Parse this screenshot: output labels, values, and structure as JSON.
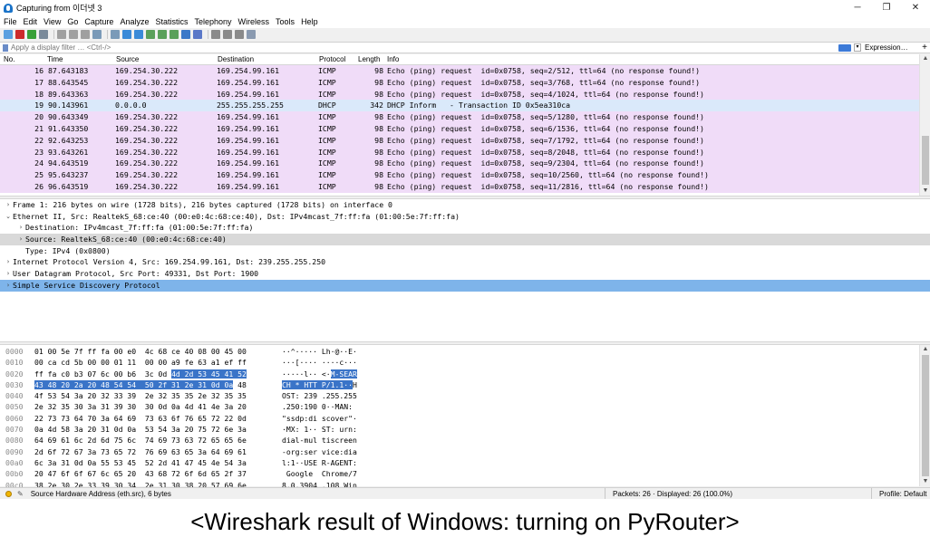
{
  "window": {
    "title": "Capturing from 이더넷 3",
    "controls": {
      "minimize": "─",
      "maximize": "❐",
      "close": "✕"
    }
  },
  "menu": [
    "File",
    "Edit",
    "View",
    "Go",
    "Capture",
    "Analyze",
    "Statistics",
    "Telephony",
    "Wireless",
    "Tools",
    "Help"
  ],
  "toolbar": {
    "icons": [
      "shark-fin-start-icon",
      "stop-capture-icon",
      "restart-capture-icon",
      "capture-options-icon",
      "open-file-icon",
      "save-file-icon",
      "close-file-icon",
      "reload-icon",
      "find-packet-icon",
      "go-back-icon",
      "go-forward-icon",
      "go-to-packet-icon",
      "go-first-icon",
      "go-last-icon",
      "autoscroll-icon",
      "colorize-icon",
      "zoom-in-icon",
      "zoom-out-icon",
      "zoom-normal-icon",
      "resize-columns-icon"
    ],
    "colors": [
      "#5aa0e0",
      "#cc2b2b",
      "#38a038",
      "#7a8a9a",
      "#a0a0a0",
      "#a0a0a0",
      "#a0a0a0",
      "#7a9ab8",
      "#7a9ab8",
      "#3a8ad8",
      "#3a8ad8",
      "#5aa05a",
      "#5aa05a",
      "#5aa05a",
      "#3a78c8",
      "#5a78c8",
      "#8a8a8a",
      "#8a8a8a",
      "#8a8a8a",
      "#8a9ab0"
    ]
  },
  "filter": {
    "placeholder": "Apply a display filter … <Ctrl-/>",
    "expression_label": "Expression…",
    "add_label": "+"
  },
  "packet_list": {
    "columns": [
      "No.",
      "Time",
      "Source",
      "Destination",
      "Protocol",
      "Length",
      "Info"
    ],
    "rows": [
      {
        "no": "16",
        "time": "87.643183",
        "src": "169.254.30.222",
        "dst": "169.254.99.161",
        "proto": "ICMP",
        "len": "98",
        "info": "Echo (ping) request  id=0x0758, seq=2/512, ttl=64 (no response found!)"
      },
      {
        "no": "17",
        "time": "88.643545",
        "src": "169.254.30.222",
        "dst": "169.254.99.161",
        "proto": "ICMP",
        "len": "98",
        "info": "Echo (ping) request  id=0x0758, seq=3/768, ttl=64 (no response found!)"
      },
      {
        "no": "18",
        "time": "89.643363",
        "src": "169.254.30.222",
        "dst": "169.254.99.161",
        "proto": "ICMP",
        "len": "98",
        "info": "Echo (ping) request  id=0x0758, seq=4/1024, ttl=64 (no response found!)"
      },
      {
        "no": "19",
        "time": "90.143961",
        "src": "0.0.0.0",
        "dst": "255.255.255.255",
        "proto": "DHCP",
        "len": "342",
        "info": "DHCP Inform   - Transaction ID 0x5ea310ca"
      },
      {
        "no": "20",
        "time": "90.643349",
        "src": "169.254.30.222",
        "dst": "169.254.99.161",
        "proto": "ICMP",
        "len": "98",
        "info": "Echo (ping) request  id=0x0758, seq=5/1280, ttl=64 (no response found!)"
      },
      {
        "no": "21",
        "time": "91.643350",
        "src": "169.254.30.222",
        "dst": "169.254.99.161",
        "proto": "ICMP",
        "len": "98",
        "info": "Echo (ping) request  id=0x0758, seq=6/1536, ttl=64 (no response found!)"
      },
      {
        "no": "22",
        "time": "92.643253",
        "src": "169.254.30.222",
        "dst": "169.254.99.161",
        "proto": "ICMP",
        "len": "98",
        "info": "Echo (ping) request  id=0x0758, seq=7/1792, ttl=64 (no response found!)"
      },
      {
        "no": "23",
        "time": "93.643261",
        "src": "169.254.30.222",
        "dst": "169.254.99.161",
        "proto": "ICMP",
        "len": "98",
        "info": "Echo (ping) request  id=0x0758, seq=8/2048, ttl=64 (no response found!)"
      },
      {
        "no": "24",
        "time": "94.643519",
        "src": "169.254.30.222",
        "dst": "169.254.99.161",
        "proto": "ICMP",
        "len": "98",
        "info": "Echo (ping) request  id=0x0758, seq=9/2304, ttl=64 (no response found!)"
      },
      {
        "no": "25",
        "time": "95.643237",
        "src": "169.254.30.222",
        "dst": "169.254.99.161",
        "proto": "ICMP",
        "len": "98",
        "info": "Echo (ping) request  id=0x0758, seq=10/2560, ttl=64 (no response found!)"
      },
      {
        "no": "26",
        "time": "96.643519",
        "src": "169.254.30.222",
        "dst": "169.254.99.161",
        "proto": "ICMP",
        "len": "98",
        "info": "Echo (ping) request  id=0x0758, seq=11/2816, ttl=64 (no response found!)"
      }
    ],
    "colors": {
      "icmp": "#f0dcf8",
      "dhcp": "#dae9fa"
    }
  },
  "details": [
    {
      "arrow": ">",
      "text": "Frame 1: 216 bytes on wire (1728 bits), 216 bytes captured (1728 bits) on interface 0",
      "indent": 0,
      "sel": ""
    },
    {
      "arrow": "v",
      "text": "Ethernet II, Src: RealtekS_68:ce:40 (00:e0:4c:68:ce:40), Dst: IPv4mcast_7f:ff:fa (01:00:5e:7f:ff:fa)",
      "indent": 0,
      "sel": ""
    },
    {
      "arrow": ">",
      "text": "Destination: IPv4mcast_7f:ff:fa (01:00:5e:7f:ff:fa)",
      "indent": 1,
      "sel": ""
    },
    {
      "arrow": ">",
      "text": "Source: RealtekS_68:ce:40 (00:e0:4c:68:ce:40)",
      "indent": 1,
      "sel": "gray"
    },
    {
      "arrow": "",
      "text": "Type: IPv4 (0x0800)",
      "indent": 1,
      "sel": ""
    },
    {
      "arrow": ">",
      "text": "Internet Protocol Version 4, Src: 169.254.99.161, Dst: 239.255.255.250",
      "indent": 0,
      "sel": ""
    },
    {
      "arrow": ">",
      "text": "User Datagram Protocol, Src Port: 49331, Dst Port: 1900",
      "indent": 0,
      "sel": ""
    },
    {
      "arrow": ">",
      "text": "Simple Service Discovery Protocol",
      "indent": 0,
      "sel": "blue"
    }
  ],
  "bytes": [
    {
      "off": "0000",
      "hex": "01 00 5e 7f ff fa 00 e0  4c 68 ce 40 08 00 45 00",
      "ascii": "··^····· Lh·@··E·"
    },
    {
      "off": "0010",
      "hex": "00 ca cd 5b 00 00 01 11  00 00 a9 fe 63 a1 ef ff",
      "ascii": "···[···· ····c···"
    },
    {
      "off": "0020",
      "hex_pre": "ff fa c0 b3 07 6c 00 b6  3c 0d ",
      "hex_hl": "4d 2d 53 45 41 52",
      "ascii_pre": "·····l·· <·",
      "ascii_hl": "M-SEAR"
    },
    {
      "off": "0030",
      "hex_hl": "43 48 20 2a 20 48 54 54  50 2f 31 2e 31 0d 0a",
      "hex_post": " 48",
      "ascii_hl": "CH * HTT P/1.1··",
      "ascii_post": "H"
    },
    {
      "off": "0040",
      "hex": "4f 53 54 3a 20 32 33 39  2e 32 35 35 2e 32 35 35",
      "ascii": "OST: 239 .255.255"
    },
    {
      "off": "0050",
      "hex": "2e 32 35 30 3a 31 39 30  30 0d 0a 4d 41 4e 3a 20",
      "ascii": ".250:190 0··MAN: "
    },
    {
      "off": "0060",
      "hex": "22 73 73 64 70 3a 64 69  73 63 6f 76 65 72 22 0d",
      "ascii": "\"ssdp:di scover\"·"
    },
    {
      "off": "0070",
      "hex": "0a 4d 58 3a 20 31 0d 0a  53 54 3a 20 75 72 6e 3a",
      "ascii": "·MX: 1·· ST: urn:"
    },
    {
      "off": "0080",
      "hex": "64 69 61 6c 2d 6d 75 6c  74 69 73 63 72 65 65 6e",
      "ascii": "dial-mul tiscreen"
    },
    {
      "off": "0090",
      "hex": "2d 6f 72 67 3a 73 65 72  76 69 63 65 3a 64 69 61",
      "ascii": "-org:ser vice:dia"
    },
    {
      "off": "00a0",
      "hex": "6c 3a 31 0d 0a 55 53 45  52 2d 41 47 45 4e 54 3a",
      "ascii": "l:1··USE R-AGENT:"
    },
    {
      "off": "00b0",
      "hex": "20 47 6f 6f 67 6c 65 20  43 68 72 6f 6d 65 2f 37",
      "ascii": " Google  Chrome/7"
    },
    {
      "off": "00c0",
      "hex": "38 2e 30 2e 33 39 30 34  2e 31 30 38 20 57 69 6e",
      "ascii": "8.0.3904 .108 Win"
    }
  ],
  "status": {
    "field_info": "Source Hardware Address (eth.src), 6 bytes",
    "packets": "Packets: 26 · Displayed: 26 (100.0%)",
    "profile": "Profile: Default"
  },
  "caption": "<Wireshark result of Windows: turning on PyRouter>"
}
